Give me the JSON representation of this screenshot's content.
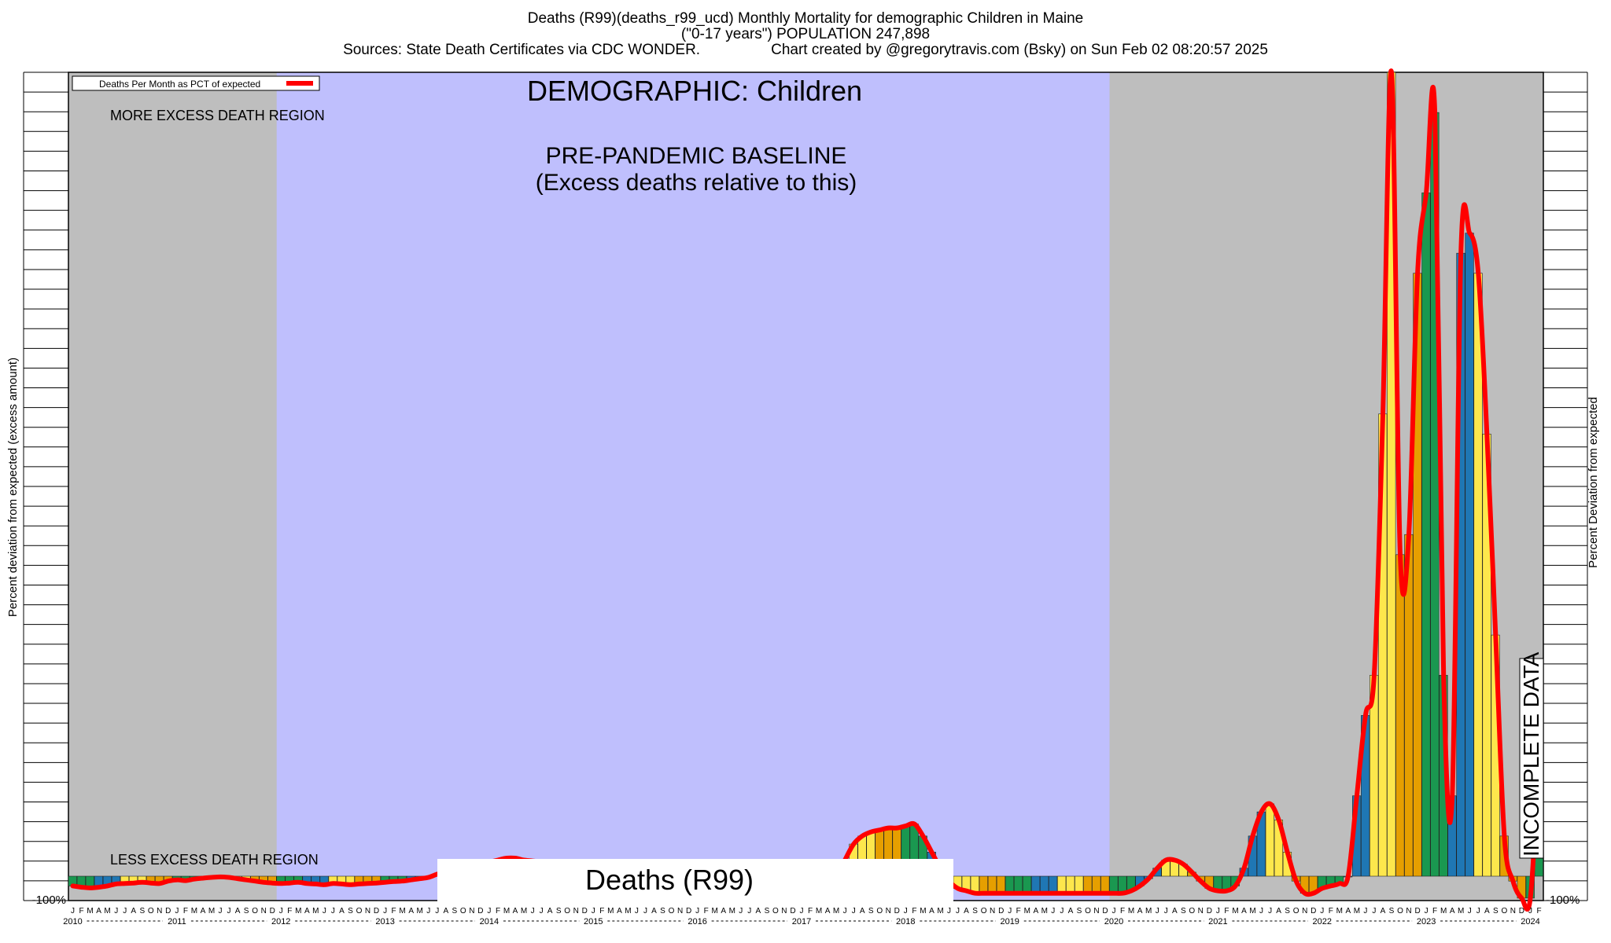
{
  "header": {
    "line1": "Deaths (R99)(deaths_r99_ucd) Monthly Mortality for demographic Children in Maine",
    "line2": "(\"0-17 years\") POPULATION 247,898",
    "line3_left": "Sources: State Death Certificates via CDC WONDER.",
    "line3_right": "Chart created by @gregorytravis.com (Bsky) on Sun Feb 02 08:20:57 2025"
  },
  "chart_data": {
    "type": "bar",
    "demographic_label": "DEMOGRAPHIC: Children",
    "baseline_label_1": "PRE-PANDEMIC BASELINE",
    "baseline_label_2": "(Excess deaths relative to this)",
    "more_region_label": "MORE EXCESS DEATH REGION",
    "less_region_label": "LESS EXCESS DEATH REGION",
    "watermark": "Deaths (R99)",
    "incomplete_label": "INCOMPLETE DATA",
    "legend": "Deaths Per Month as PCT of expected",
    "ylabel_left": "Percent deviation from expected (excess amount)",
    "ylabel_right": "Percent Deviation from expected",
    "ytick_bottom_left": "-100%",
    "ytick_bottom_right": "-100%",
    "baseline_period": "2012-01 to 2019-12",
    "x_start": "2010-01",
    "x_end": "2024-02",
    "month_letters": [
      "J",
      "F",
      "M",
      "A",
      "M",
      "J",
      "J",
      "A",
      "S",
      "O",
      "N",
      "D"
    ],
    "years": [
      "2010",
      "2011",
      "2012",
      "2013",
      "2014",
      "2015",
      "2016",
      "2017",
      "2018",
      "2019",
      "2020",
      "2021",
      "2022",
      "2023",
      "2024"
    ],
    "ylim": [
      -100,
      2000
    ],
    "colors": {
      "bar_colors": [
        "#1a9850",
        "#1a9850",
        "#1a9850",
        "#1f77b4",
        "#1f77b4",
        "#1f77b4",
        "#fde74c",
        "#fde74c",
        "#fde74c",
        "#e69f00",
        "#e69f00",
        "#e69f00"
      ],
      "line": "#ff0000",
      "baseline_band": "#bfbffd",
      "outside_band": "#bebebe"
    },
    "series": [
      {
        "name": "Deaths Per Month as PCT of expected",
        "values": [
          -40,
          -45,
          -48,
          -45,
          -40,
          -32,
          -30,
          -28,
          -25,
          -28,
          -30,
          -20,
          -15,
          -18,
          -12,
          -8,
          -5,
          -3,
          -5,
          -10,
          -15,
          -20,
          -25,
          -28,
          -30,
          -28,
          -25,
          -30,
          -32,
          -35,
          -30,
          -32,
          -35,
          -32,
          -30,
          -28,
          -25,
          -22,
          -20,
          -15,
          -10,
          -5,
          5,
          10,
          15,
          20,
          25,
          30,
          35,
          40,
          45,
          45,
          40,
          38,
          35,
          30,
          20,
          10,
          0,
          -10,
          -20,
          -30,
          -40,
          -50,
          -55,
          -60,
          -60,
          -55,
          -50,
          -45,
          -40,
          -35,
          -30,
          -25,
          -20,
          -15,
          -10,
          -5,
          0,
          0,
          -5,
          -10,
          -15,
          -20,
          -30,
          -40,
          -50,
          -40,
          -10,
          40,
          80,
          100,
          110,
          115,
          120,
          120,
          125,
          130,
          100,
          60,
          20,
          -20,
          -50,
          -60,
          -70,
          -70,
          -70,
          -70,
          -70,
          -70,
          -70,
          -70,
          -70,
          -70,
          -70,
          -70,
          -70,
          -70,
          -70,
          -70,
          -70,
          -70,
          -60,
          -40,
          -10,
          20,
          40,
          40,
          30,
          10,
          -20,
          -50,
          -60,
          -60,
          -40,
          20,
          100,
          160,
          180,
          140,
          60,
          -20,
          -70,
          -70,
          -50,
          -40,
          -30,
          0,
          200,
          400,
          500,
          1150,
          2000,
          800,
          850,
          1500,
          1700,
          1900,
          500,
          200,
          1550,
          1600,
          1500,
          1100,
          600,
          100,
          -20,
          -90,
          -90,
          300
        ]
      }
    ]
  }
}
